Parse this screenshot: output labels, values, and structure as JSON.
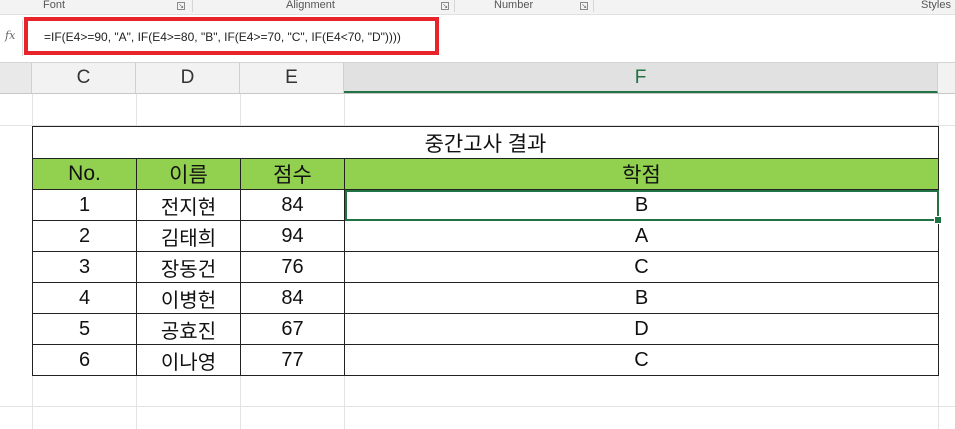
{
  "ribbon": {
    "groups": [
      "Font",
      "Alignment",
      "Number",
      "Styles"
    ]
  },
  "formula_bar": {
    "fx_label": "fx",
    "formula": "=IF(E4>=90, \"A\", IF(E4>=80, \"B\", IF(E4>=70, \"C\", IF(E4<70, \"D\"))))"
  },
  "columns": [
    "C",
    "D",
    "E",
    "F"
  ],
  "table": {
    "title": "중간고사 결과",
    "headers": [
      "No.",
      "이름",
      "점수",
      "학점"
    ],
    "rows": [
      [
        "1",
        "전지현",
        "84",
        "B"
      ],
      [
        "2",
        "김태희",
        "94",
        "A"
      ],
      [
        "3",
        "장동건",
        "76",
        "C"
      ],
      [
        "4",
        "이병헌",
        "84",
        "B"
      ],
      [
        "5",
        "공효진",
        "67",
        "D"
      ],
      [
        "6",
        "이나영",
        "77",
        "C"
      ]
    ]
  },
  "colors": {
    "header_fill": "#92d050",
    "highlight_box": "#e8242b",
    "selection": "#217346"
  }
}
